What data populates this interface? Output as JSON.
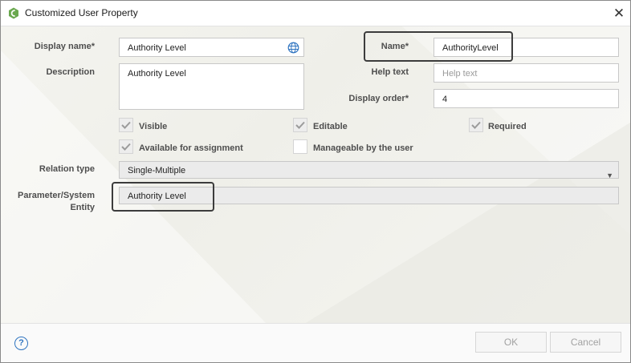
{
  "window": {
    "title": "Customized User Property",
    "icon": "app-logo-icon",
    "close_glyph": "✕"
  },
  "form": {
    "display_name": {
      "label": "Display name*",
      "value": "Authority Level"
    },
    "description": {
      "label": "Description",
      "value": "Authority Level"
    },
    "name": {
      "label": "Name*",
      "value": "AuthorityLevel"
    },
    "help_text": {
      "label": "Help text",
      "placeholder": "Help text"
    },
    "display_order": {
      "label": "Display order*",
      "value": "4"
    },
    "checkboxes": [
      {
        "label": "Visible",
        "checked": true
      },
      {
        "label": "Editable",
        "checked": true
      },
      {
        "label": "Required",
        "checked": true
      },
      {
        "label": "Available for assignment",
        "checked": true
      },
      {
        "label": "Manageable by the user",
        "checked": false
      }
    ],
    "relation_type": {
      "label": "Relation type",
      "value": "Single-Multiple"
    },
    "parameter_entity": {
      "label_line1": "Parameter/System",
      "label_line2": "Entity",
      "value": "Authority Level"
    }
  },
  "footer": {
    "help_glyph": "?",
    "ok_label": "OK",
    "cancel_label": "Cancel"
  },
  "colors": {
    "accent": "#2f74c0",
    "logo_green": "#6aa84f",
    "label": "#4e4e4e",
    "highlight_border": "#3c3c3c"
  }
}
